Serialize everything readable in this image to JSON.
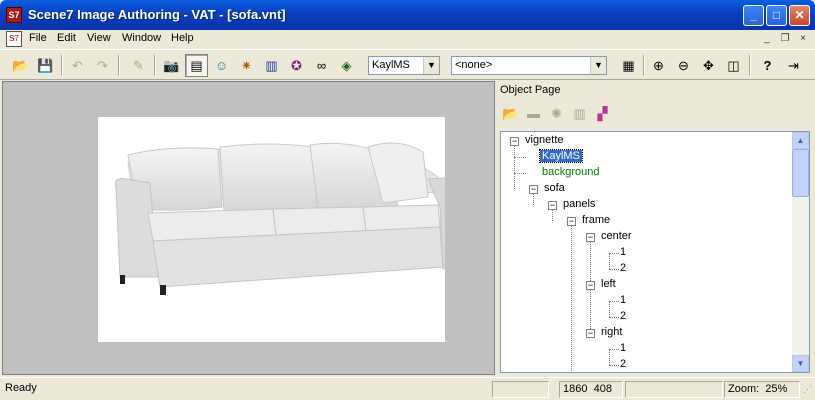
{
  "window": {
    "title": "Scene7 Image Authoring - VAT - [sofa.vnt]",
    "app_icon_text": "S7"
  },
  "window_controls": {
    "minimize": "_",
    "maximize": "□",
    "close": "✕"
  },
  "menu": {
    "items": [
      "File",
      "Edit",
      "View",
      "Window",
      "Help"
    ],
    "mdi_minimize": "_",
    "mdi_restore": "❐",
    "mdi_close": "×"
  },
  "toolbar": {
    "combo1_value": "KaylMS",
    "combo2_value": "<none>",
    "icons": {
      "open": "📂",
      "save": "💾",
      "undo": "↶",
      "redo": "↷",
      "edit": "✎",
      "camera": "📷",
      "page": "▤",
      "mask": "☺",
      "light": "✷",
      "book": "▥",
      "star": "✪",
      "link": "∞",
      "layer": "◈",
      "props": "▦",
      "zoom_in": "⊕",
      "zoom_out": "⊖",
      "fit": "✥",
      "split": "◫",
      "help": "?",
      "exit": "⇥"
    }
  },
  "object_page": {
    "title": "Object Page",
    "toolbar_icons": {
      "open": "📂",
      "remove": "▬",
      "settings": "✺",
      "frame": "▥",
      "rgb": "▞"
    },
    "tree": {
      "vignette": "vignette",
      "kaylms": "KaylMS",
      "background": "background",
      "sofa": "sofa",
      "panels": "panels",
      "frame": "frame",
      "center": "center",
      "center_1": "1",
      "center_2": "2",
      "left": "left",
      "left_1": "1",
      "left_2": "2",
      "right": "right",
      "right_1": "1",
      "right_2": "2"
    },
    "expander_glyph": "−"
  },
  "status": {
    "text": "Ready",
    "coords": "1860  408",
    "zoom": "Zoom:  25%"
  }
}
